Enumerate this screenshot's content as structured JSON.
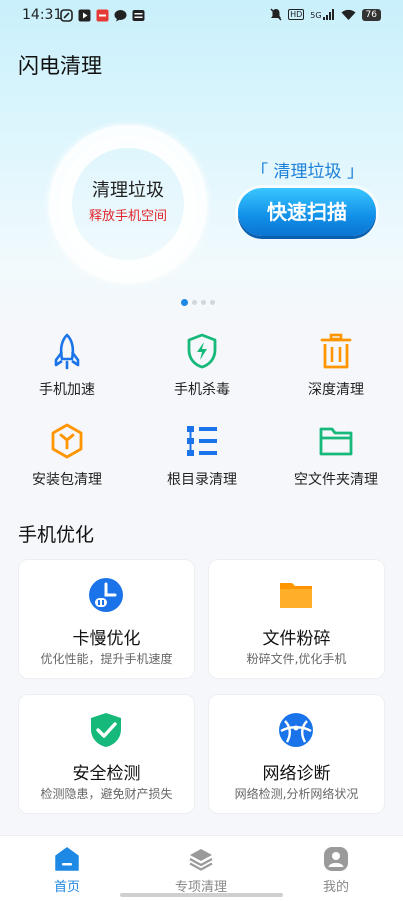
{
  "status_bar": {
    "time": "14:31",
    "network": "5G",
    "hd": "HD",
    "battery": "76"
  },
  "header": {
    "title": "闪电清理"
  },
  "hero": {
    "ring_title": "清理垃圾",
    "ring_subtitle": "释放手机空间",
    "promo_label": "「 清理垃圾 」",
    "scan_button": "快速扫描",
    "carousel_pages": 4,
    "carousel_active": 0
  },
  "tools": [
    {
      "label": "手机加速",
      "icon": "rocket-icon"
    },
    {
      "label": "手机杀毒",
      "icon": "shield-bolt-icon"
    },
    {
      "label": "深度清理",
      "icon": "trash-icon"
    },
    {
      "label": "安装包清理",
      "icon": "package-icon"
    },
    {
      "label": "根目录清理",
      "icon": "directory-tree-icon"
    },
    {
      "label": "空文件夹清理",
      "icon": "empty-folder-icon"
    }
  ],
  "optimization": {
    "title": "手机优化",
    "cards": [
      {
        "title": "卡慢优化",
        "subtitle": "优化性能，提升手机速度",
        "icon": "speed-clock-icon"
      },
      {
        "title": "文件粉碎",
        "subtitle": "粉碎文件,优化手机",
        "icon": "folder-icon"
      },
      {
        "title": "安全检测",
        "subtitle": "检测隐患，避免财产损失",
        "icon": "shield-check-icon"
      },
      {
        "title": "网络诊断",
        "subtitle": "网络检测,分析网络状况",
        "icon": "network-globe-icon"
      }
    ]
  },
  "bottom_nav": [
    {
      "label": "首页",
      "icon": "home-icon",
      "active": true
    },
    {
      "label": "专项清理",
      "icon": "layers-icon",
      "active": false
    },
    {
      "label": "我的",
      "icon": "profile-icon",
      "active": false
    }
  ],
  "colors": {
    "accent": "#1e88e5",
    "alert_red": "#e0262b",
    "tool_blue": "#1a73e8",
    "tool_green": "#16b97a",
    "tool_orange": "#ff9500",
    "nav_inactive": "#888888"
  }
}
